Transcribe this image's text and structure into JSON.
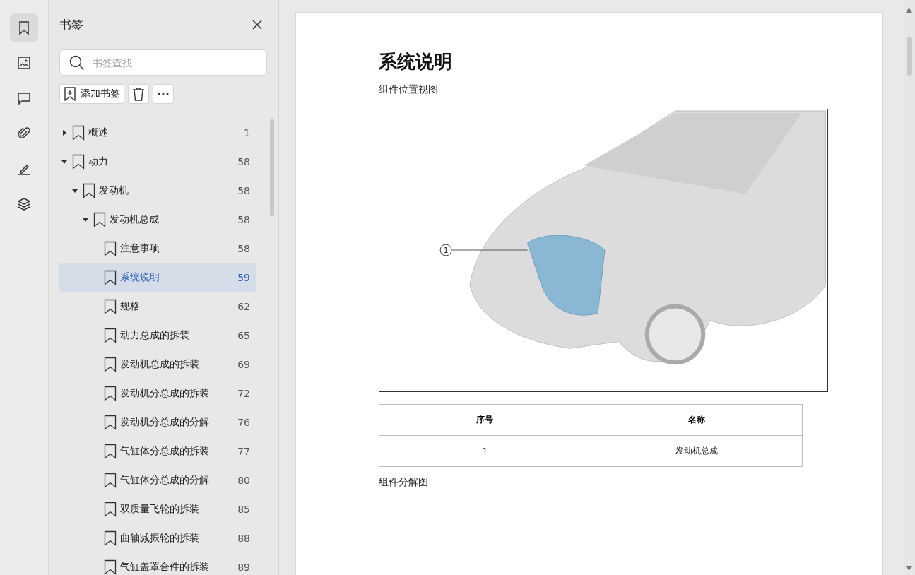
{
  "rail": {
    "items": [
      {
        "kind": "bookmark",
        "selected": true
      },
      {
        "kind": "image",
        "selected": false
      },
      {
        "kind": "comment",
        "selected": false
      },
      {
        "kind": "attachment",
        "selected": false
      },
      {
        "kind": "sign",
        "selected": false
      },
      {
        "kind": "layers",
        "selected": false
      }
    ]
  },
  "panel": {
    "title": "书签",
    "search": {
      "placeholder": "书签查找"
    },
    "add_button": "添加书签",
    "tree": [
      {
        "label": "概述",
        "page": "1",
        "selected": false,
        "expanded": false
      },
      {
        "label": "动力",
        "page": "58",
        "selected": false,
        "expanded": true,
        "children": [
          {
            "label": "发动机",
            "page": "58",
            "selected": false,
            "expanded": true,
            "children": [
              {
                "label": "发动机总成",
                "page": "58",
                "selected": false,
                "expanded": true,
                "children": [
                  {
                    "label": "注意事项",
                    "page": "58",
                    "selected": false
                  },
                  {
                    "label": "系统说明",
                    "page": "59",
                    "selected": true
                  },
                  {
                    "label": "规格",
                    "page": "62",
                    "selected": false
                  },
                  {
                    "label": "动力总成的拆装",
                    "page": "65",
                    "selected": false
                  },
                  {
                    "label": "发动机总成的拆装",
                    "page": "69",
                    "selected": false
                  },
                  {
                    "label": "发动机分总成的拆装",
                    "page": "72",
                    "selected": false
                  },
                  {
                    "label": "发动机分总成的分解",
                    "page": "76",
                    "selected": false
                  },
                  {
                    "label": "气缸体分总成的拆装",
                    "page": "77",
                    "selected": false
                  },
                  {
                    "label": "气缸体分总成的分解",
                    "page": "80",
                    "selected": false
                  },
                  {
                    "label": "双质量飞轮的拆装",
                    "page": "85",
                    "selected": false
                  },
                  {
                    "label": "曲轴减振轮的拆装",
                    "page": "88",
                    "selected": false
                  },
                  {
                    "label": "气缸盖罩合件的拆装",
                    "page": "89",
                    "selected": false
                  }
                ]
              }
            ]
          }
        ]
      }
    ]
  },
  "document": {
    "title": "系统说明",
    "section_1": "组件位置视图",
    "callout": "1",
    "table": {
      "columns": [
        "序号",
        "名称"
      ],
      "rows": [
        [
          "1",
          "发动机总成"
        ]
      ]
    },
    "section_2": "组件分解图"
  }
}
